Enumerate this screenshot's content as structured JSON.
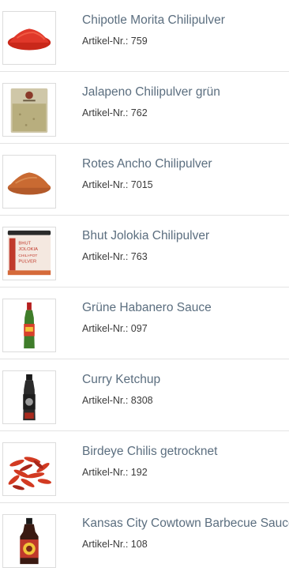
{
  "products": [
    {
      "name": "Chipotle Morita Chilipulver",
      "sku": "Artikel-Nr.: 759",
      "image": "red-chili-powder-pile"
    },
    {
      "name": "Jalapeno Chilipulver grün",
      "sku": "Artikel-Nr.: 762",
      "image": "green-powder-bag"
    },
    {
      "name": "Rotes Ancho Chilipulver",
      "sku": "Artikel-Nr.: 7015",
      "image": "brown-chili-powder-pile"
    },
    {
      "name": "Bhut Jolokia Chilipulver",
      "sku": "Artikel-Nr.: 763",
      "image": "spice-jar",
      "image_text": [
        "BHUT",
        "JOLOKIA",
        "CHILI-POT",
        "PULVER"
      ]
    },
    {
      "name": "Grüne Habanero Sauce",
      "sku": "Artikel-Nr.: 097",
      "image": "green-sauce-bottle"
    },
    {
      "name": "Curry Ketchup",
      "sku": "Artikel-Nr.: 8308",
      "image": "ketchup-bottle"
    },
    {
      "name": "Birdeye Chilis getrocknet",
      "sku": "Artikel-Nr.: 192",
      "image": "dried-red-chilis"
    },
    {
      "name": "Kansas City Cowtown Barbecue Sauce",
      "sku": "Artikel-Nr.: 108",
      "image": "bbq-sauce-bottle"
    }
  ]
}
